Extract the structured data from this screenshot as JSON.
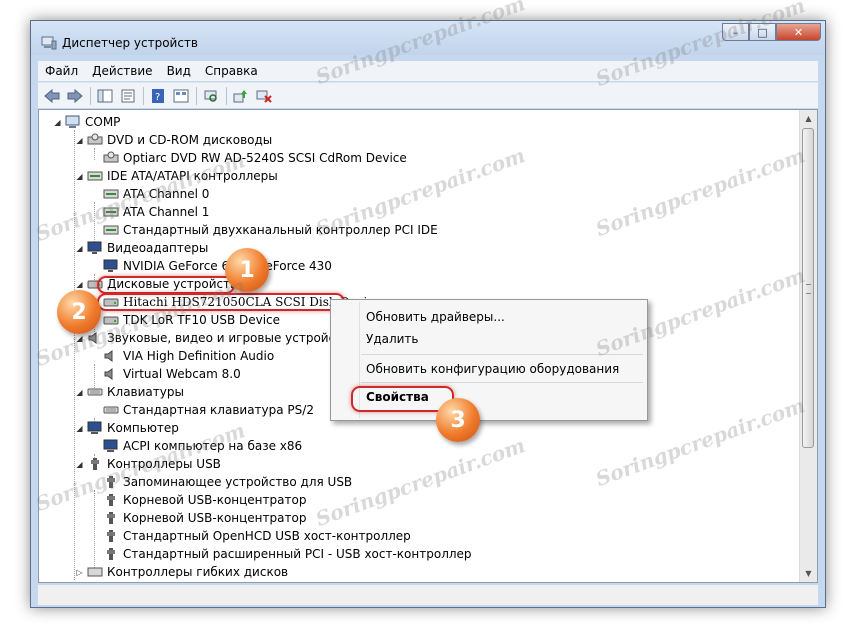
{
  "window": {
    "title": "Диспетчер устройств",
    "buttons": {
      "minimize": "–",
      "maximize": "□",
      "close": "✕"
    }
  },
  "menu": [
    "Файл",
    "Действие",
    "Вид",
    "Справка"
  ],
  "tree": {
    "root": "COMP",
    "items": [
      "DVD и CD-ROM дисководы",
      "Optiarc DVD RW AD-5240S SCSI CdRom Device",
      "IDE ATA/ATAPI контроллеры",
      "ATA Channel 0",
      "ATA Channel 1",
      "Стандартный двухканальный контроллер PCI IDE",
      "Видеоадаптеры",
      "NVIDIA GeForce 615 / GeForce 430",
      "Дисковые устройства",
      "Hitachi HDS721050CLA SCSI Disk Device",
      "TDK LoR TF10 USB Device",
      "Звуковые, видео и игровые устройства",
      "VIA High Definition Audio",
      "Virtual Webcam 8.0",
      "Клавиатуры",
      "Стандартная клавиатура PS/2",
      "Компьютер",
      "ACPI компьютер на базе x86",
      "Контроллеры USB",
      "Запоминающее устройство для USB",
      "Корневой USB-концентратор",
      "Корневой USB-концентратор",
      "Стандартный OpenHCD USB хост-контроллер",
      "Стандартный расширенный PCI - USB хост-контроллер",
      "Контроллеры гибких дисков"
    ]
  },
  "context_menu": {
    "update_drivers": "Обновить драйверы...",
    "delete": "Удалить",
    "scan": "Обновить конфигурацию оборудования",
    "properties": "Свойства"
  },
  "badges": [
    "1",
    "2",
    "3"
  ],
  "watermark": "Soringpcrepair.com",
  "colors": {
    "highlight_outline": "#cc2a2a",
    "badge": "#f07a2a"
  }
}
